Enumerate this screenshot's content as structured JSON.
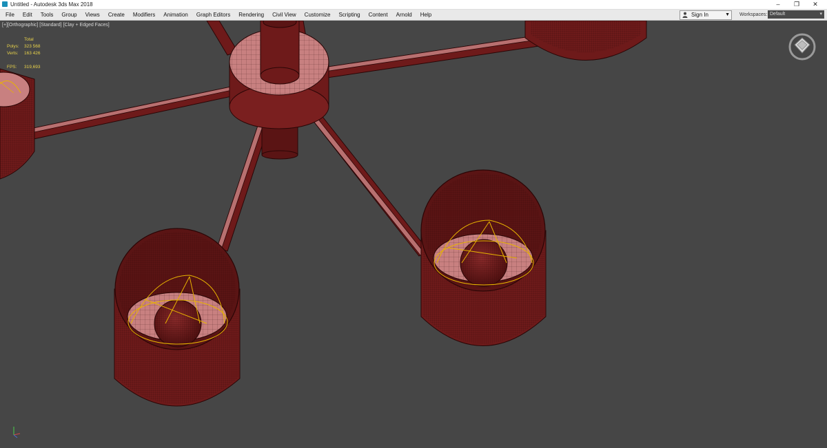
{
  "window": {
    "title": "Untitled - Autodesk 3ds Max 2018",
    "controls": {
      "minimize": "–",
      "restore": "❐",
      "close": "✕"
    }
  },
  "menubar": {
    "items": [
      "File",
      "Edit",
      "Tools",
      "Group",
      "Views",
      "Create",
      "Modifiers",
      "Animation",
      "Graph Editors",
      "Rendering",
      "Civil View",
      "Customize",
      "Scripting",
      "Content",
      "Arnold",
      "Help"
    ]
  },
  "account": {
    "sign_in_label": "Sign In",
    "workspaces_label": "Workspaces:",
    "workspace_value": "Default"
  },
  "viewport": {
    "label_parts": [
      "[+]",
      "[Orthographic]",
      "[Standard]",
      "[Clay + Edged Faces]"
    ],
    "stats": {
      "total_label": "Total",
      "polys_label": "Polys:",
      "polys_value": "323 568",
      "verts_label": "Verts:",
      "verts_value": "163 426",
      "fps_label": "FPS:",
      "fps_value": "319,693"
    },
    "colors": {
      "background": "#464646",
      "mesh_fill": "#6e1a1a",
      "mesh_light": "#c88080",
      "wire": "#2a0606",
      "selection": "#e8b400",
      "stats_text": "#e8d24a"
    },
    "icons": [
      "viewcube-icon",
      "axis-tripod-icon",
      "user-icon"
    ]
  }
}
